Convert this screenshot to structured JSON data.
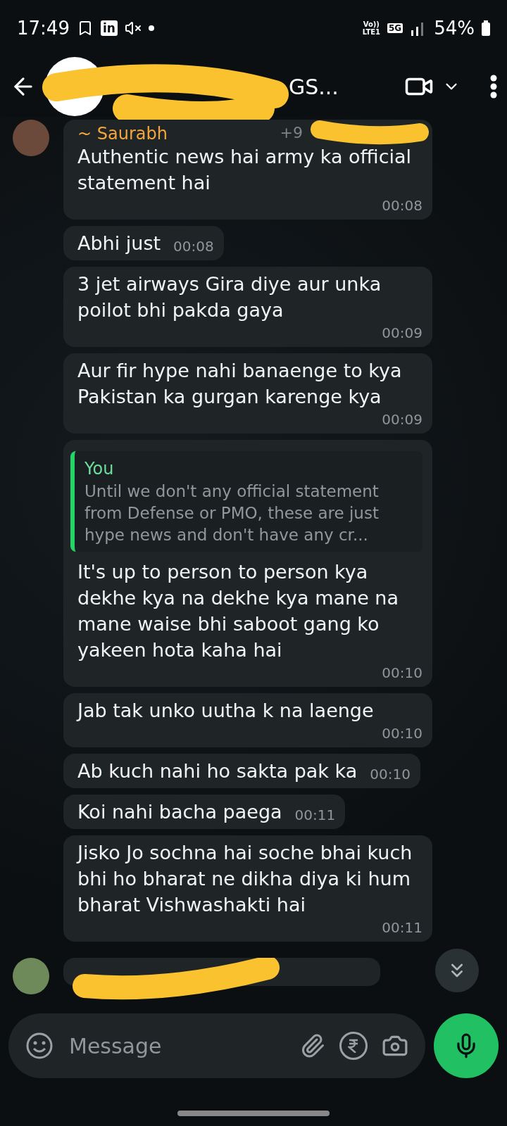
{
  "status_bar": {
    "time": "17:49",
    "app_badge": "in",
    "volte": "Vo))",
    "lte": "LTE1",
    "network": "5G",
    "battery": "54%"
  },
  "header": {
    "title": "GS..."
  },
  "messages": [
    {
      "kind": "first",
      "sender": "~ Saurabh",
      "phone": "+9",
      "text": "Authentic news hai army ka official statement hai",
      "time": "00:08"
    },
    {
      "kind": "text",
      "text": "Abhi just",
      "time": "00:08"
    },
    {
      "kind": "text",
      "text": "3 jet airways Gira diye aur unka poilot bhi pakda gaya",
      "time": "00:09"
    },
    {
      "kind": "text",
      "text": "Aur fir hype nahi banaenge to kya Pakistan ka gurgan karenge kya",
      "time": "00:09"
    },
    {
      "kind": "reply",
      "quote_author": "You",
      "quote": "Until we don't any official statement from Defense or PMO, these are just hype news and don't have any cr...",
      "text": "It's up to person to person kya dekhe kya na dekhe kya mane na mane waise bhi saboot gang ko yakeen hota kaha hai",
      "time": "00:10"
    },
    {
      "kind": "text",
      "text": "Jab tak unko uutha k na laenge",
      "time": "00:10"
    },
    {
      "kind": "text",
      "text": "Ab kuch nahi ho sakta pak ka",
      "time": "00:10"
    },
    {
      "kind": "text",
      "text": "Koi nahi bacha paega",
      "time": "00:11"
    },
    {
      "kind": "text",
      "text": "Jisko Jo sochna hai soche bhai kuch bhi ho bharat ne dikha diya ki hum bharat Vishwashakti hai",
      "time": "00:11"
    },
    {
      "kind": "redacted"
    }
  ],
  "composer": {
    "placeholder": "Message"
  }
}
